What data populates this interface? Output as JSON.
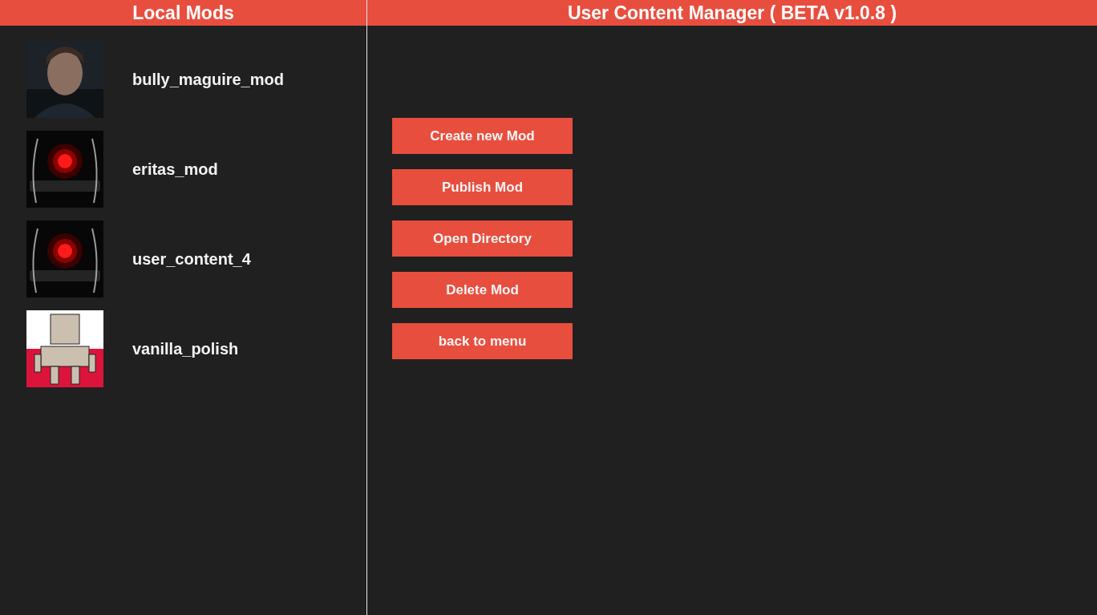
{
  "left_panel": {
    "title": "Local Mods",
    "mods": [
      {
        "name": "bully_maguire_mod"
      },
      {
        "name": "eritas_mod"
      },
      {
        "name": "user_content_4"
      },
      {
        "name": "vanilla_polish"
      }
    ]
  },
  "right_panel": {
    "title": "User Content Manager ( BETA v1.0.8 )",
    "buttons": [
      "Create new Mod",
      "Publish Mod",
      "Open Directory",
      "Delete Mod",
      "back to menu"
    ]
  }
}
